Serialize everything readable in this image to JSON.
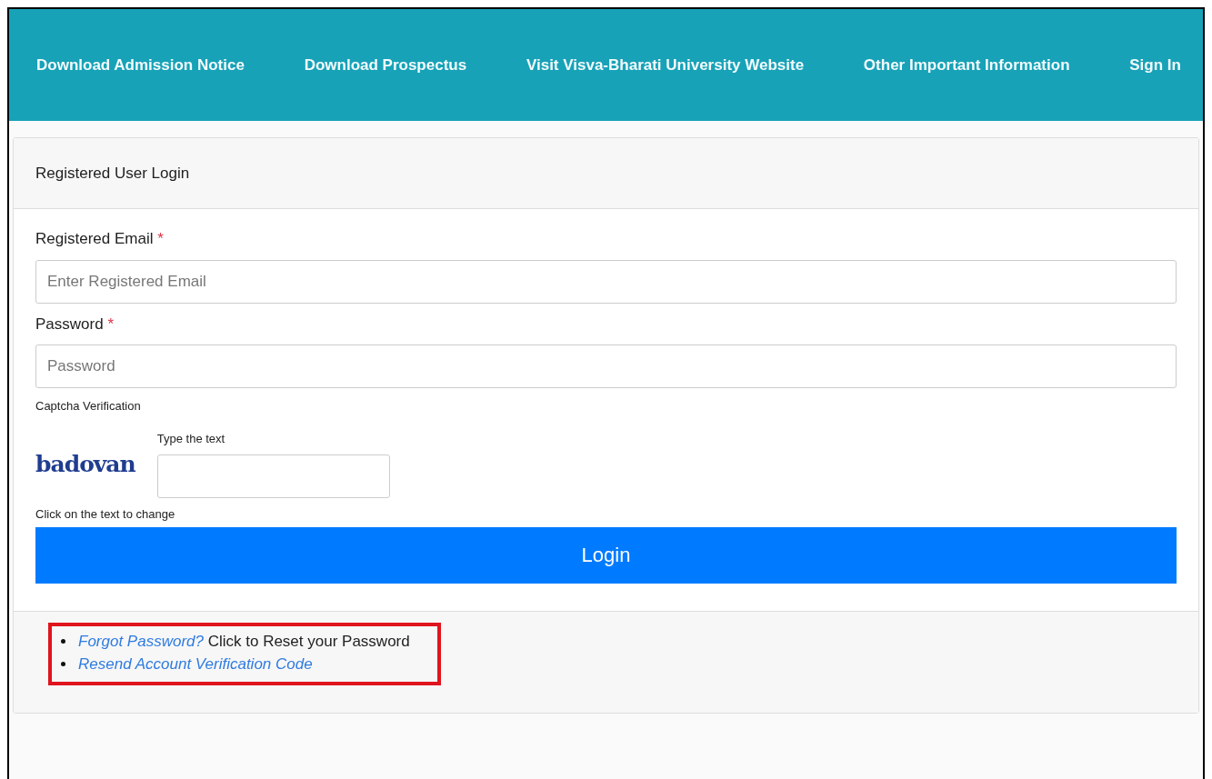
{
  "navbar": {
    "links": [
      {
        "label": "Download Admission Notice"
      },
      {
        "label": "Download Prospectus"
      },
      {
        "label": "Visit Visva-Bharati University Website"
      },
      {
        "label": "Other Important Information"
      },
      {
        "label": "Sign In"
      }
    ]
  },
  "login_card": {
    "header": "Registered User Login",
    "fields": [
      {
        "label": "Registered Email",
        "required_mark": "*",
        "placeholder": "Enter Registered Email"
      },
      {
        "label": "Password",
        "required_mark": "*",
        "placeholder": "Password"
      }
    ],
    "captcha": {
      "heading": "Captcha Verification",
      "image_text": "badovan",
      "input_label": "Type the text",
      "hint": "Click on the text to change"
    },
    "button": "Login",
    "footer_links": [
      {
        "link": "Forgot Password?",
        "text": "Click to Reset your Password"
      },
      {
        "link": "Resend Account Verification Code"
      }
    ]
  }
}
